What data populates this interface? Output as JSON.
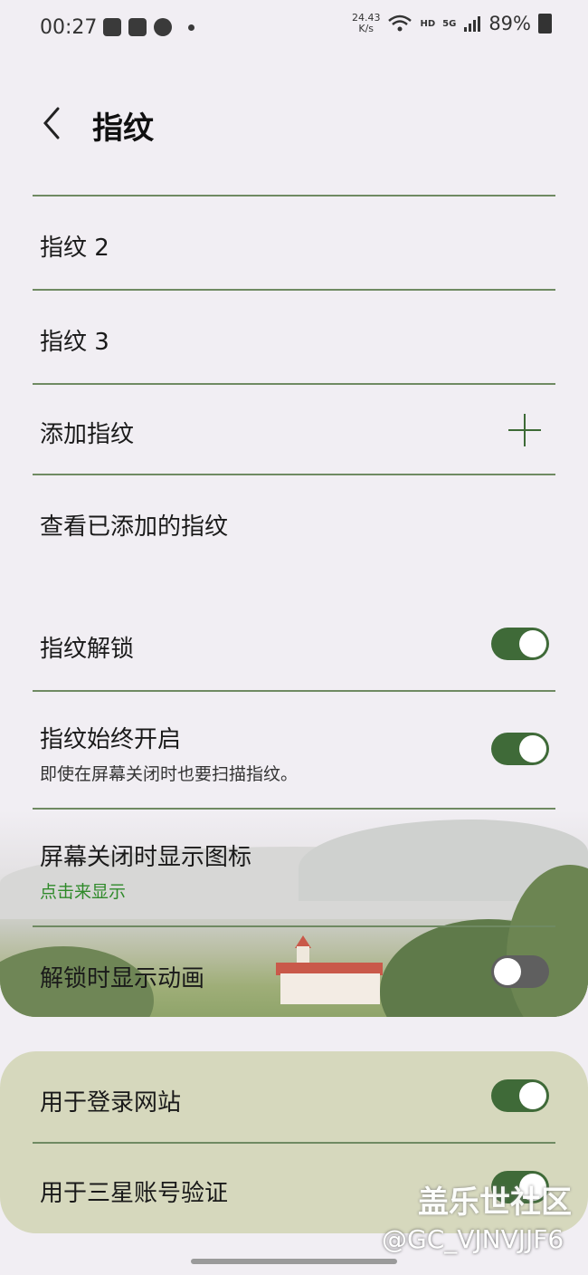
{
  "status_bar": {
    "time": "00:27",
    "speed_value": "24.43",
    "speed_unit": "K/s",
    "hd": "HD",
    "network": "5G",
    "battery": "89%"
  },
  "header": {
    "title": "指纹"
  },
  "fingerprints": [
    {
      "label": "指纹 2"
    },
    {
      "label": "指纹 3"
    }
  ],
  "add_fingerprint": "添加指纹",
  "view_fingerprints": "查看已添加的指纹",
  "settings": {
    "unlock": {
      "label": "指纹解锁",
      "enabled": true
    },
    "always_on": {
      "label": "指纹始终开启",
      "sub": "即使在屏幕关闭时也要扫描指纹。",
      "enabled": true
    },
    "screen_off_icon": {
      "label": "屏幕关闭时显示图标",
      "sub": "点击来显示"
    },
    "unlock_animation": {
      "label": "解锁时显示动画",
      "enabled": false
    }
  },
  "usage": {
    "web_login": {
      "label": "用于登录网站",
      "enabled": true
    },
    "samsung_account": {
      "label": "用于三星账号验证",
      "enabled": true
    }
  },
  "watermark": {
    "site": "盖乐世社区",
    "user": "@GC_VJNVJJF6"
  },
  "colors": {
    "accent": "#3f6a38",
    "divider": "#6f8a62",
    "link_green": "#2f8a2a"
  }
}
